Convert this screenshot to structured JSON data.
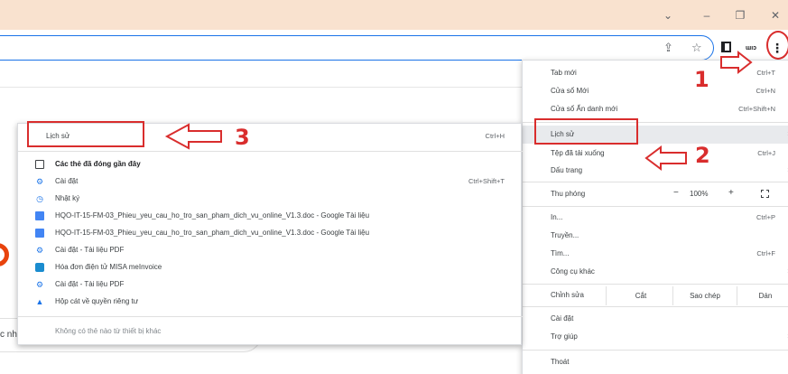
{
  "window": {
    "chevron_icon": "chevron-down-icon",
    "min_glyph": "–",
    "max_glyph": "❐",
    "close_glyph": "✕"
  },
  "toolbar": {
    "share_glyph": "⇪",
    "star_glyph": "☆",
    "ext_label": "ɯıɔ",
    "kebab_glyph": "⋮"
  },
  "page": {
    "snippet": "c nh"
  },
  "menu": {
    "new_tab": {
      "label": "Tab mới",
      "shortcut": "Ctrl+T"
    },
    "new_window": {
      "label": "Cửa sổ Mới",
      "shortcut": "Ctrl+N"
    },
    "incognito": {
      "label": "Cửa sổ Ẩn danh mới",
      "shortcut": "Ctrl+Shift+N"
    },
    "history": {
      "label": "Lịch sử"
    },
    "downloads": {
      "label": "Tệp đã tải xuống",
      "shortcut": "Ctrl+J"
    },
    "bookmarks": {
      "label": "Dấu trang"
    },
    "zoom": {
      "label": "Thu phóng",
      "minus": "−",
      "value": "100%",
      "plus": "+"
    },
    "print": {
      "label": "In...",
      "shortcut": "Ctrl+P"
    },
    "cast": {
      "label": "Truyền..."
    },
    "find": {
      "label": "Tìm...",
      "shortcut": "Ctrl+F"
    },
    "more_tools": {
      "label": "Công cụ khác"
    },
    "edit": {
      "label": "Chỉnh sửa",
      "cut": "Cắt",
      "copy": "Sao chép",
      "paste": "Dán"
    },
    "settings": {
      "label": "Cài đặt"
    },
    "help": {
      "label": "Trợ giúp"
    },
    "exit": {
      "label": "Thoát"
    },
    "submenu_arrow": "›"
  },
  "history_submenu": {
    "history": {
      "label": "Lịch sử",
      "shortcut": "Ctrl+H"
    },
    "recent_tabs": {
      "label": "Các thẻ đã đóng gần đây"
    },
    "settings": {
      "label": "Cài đặt",
      "shortcut": "Ctrl+Shift+T"
    },
    "log": {
      "label": "Nhật ký"
    },
    "entries": [
      {
        "label": "HQO-IT-15-FM-03_Phieu_yeu_cau_ho_tro_san_pham_dich_vu_online_V1.3.doc - Google Tài liệu",
        "icon": "google-docs-icon"
      },
      {
        "label": "HQO-IT-15-FM-03_Phieu_yeu_cau_ho_tro_san_pham_dich_vu_online_V1.3.doc - Google Tài liệu",
        "icon": "google-docs-icon"
      },
      {
        "label": "Cài đặt - Tài liệu PDF",
        "icon": "gear-icon"
      },
      {
        "label": "Hóa đơn điện tử MISA meInvoice",
        "icon": "misa-icon"
      },
      {
        "label": "Cài đặt - Tài liệu PDF",
        "icon": "gear-icon"
      },
      {
        "label": "Hộp cát về quyền riêng tư",
        "icon": "flask-icon"
      }
    ],
    "no_tabs": {
      "label": "Không có thẻ nào từ thiết bị khác"
    }
  },
  "annotations": {
    "step1": "1",
    "step2": "2",
    "step3": "3",
    "color": "#d92d2d"
  }
}
